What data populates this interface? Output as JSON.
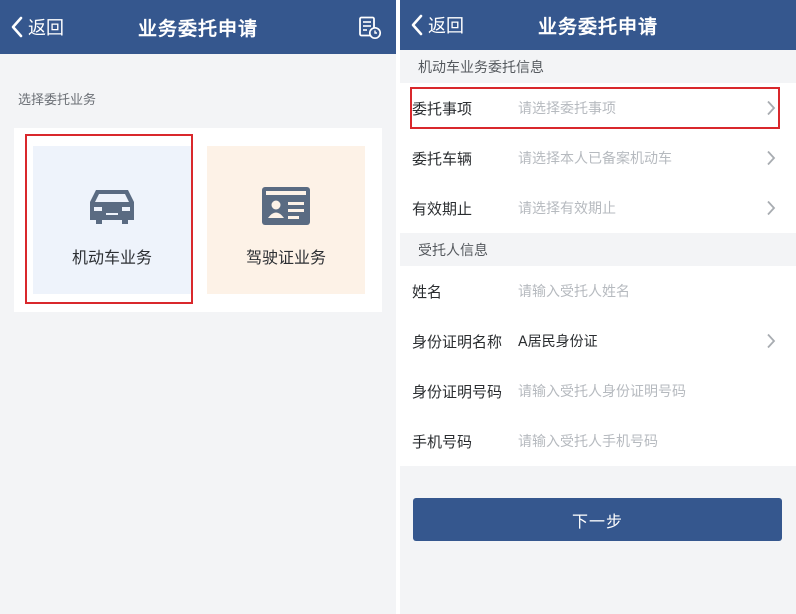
{
  "left_screen": {
    "nav": {
      "back_label": "返回",
      "title": "业务委托申请",
      "right_icon": "record-list-icon"
    },
    "prompt": "选择委托业务",
    "cards": [
      {
        "label": "机动车业务",
        "icon": "car-icon",
        "bg": "#eef3fb",
        "highlighted": true
      },
      {
        "label": "驾驶证业务",
        "icon": "license-card-icon",
        "bg": "#fdf2e7",
        "highlighted": false
      }
    ]
  },
  "right_screen": {
    "nav": {
      "back_label": "返回",
      "title": "业务委托申请"
    },
    "sections": [
      {
        "title": "机动车业务委托信息",
        "rows": [
          {
            "label": "委托事项",
            "placeholder": "请选择委托事项",
            "has_chevron": true,
            "highlighted": true
          },
          {
            "label": "委托车辆",
            "placeholder": "请选择本人已备案机动车",
            "has_chevron": true
          },
          {
            "label": "有效期止",
            "placeholder": "请选择有效期止",
            "has_chevron": true
          }
        ]
      },
      {
        "title": "受托人信息",
        "rows": [
          {
            "label": "姓名",
            "placeholder": "请输入受托人姓名",
            "has_chevron": false
          },
          {
            "label": "身份证明名称",
            "value": "A居民身份证",
            "has_chevron": true
          },
          {
            "label": "身份证明号码",
            "placeholder": "请输入受托人身份证明号码",
            "has_chevron": false
          },
          {
            "label": "手机号码",
            "placeholder": "请输入受托人手机号码",
            "has_chevron": false
          }
        ]
      }
    ],
    "next_button": "下一步"
  },
  "colors": {
    "nav_bg": "#35578e",
    "highlight_border": "#d9282c",
    "placeholder": "#b6babf",
    "page_bg": "#f3f4f6"
  }
}
